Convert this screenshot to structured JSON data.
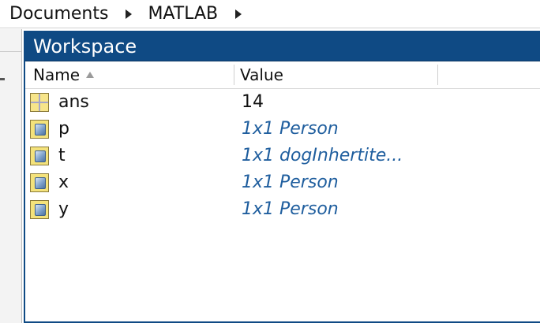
{
  "breadcrumb": {
    "items": [
      "Documents",
      "MATLAB"
    ]
  },
  "workspace": {
    "title": "Workspace",
    "columns": {
      "name": "Name",
      "value": "Value"
    },
    "variables": [
      {
        "name": "ans",
        "value": "14",
        "icon": "numeric-array-icon"
      },
      {
        "name": "p",
        "value": "1x1 Person",
        "icon": "object-icon"
      },
      {
        "name": "t",
        "value": "1x1 dogInhertite...",
        "icon": "object-icon"
      },
      {
        "name": "x",
        "value": "1x1 Person",
        "icon": "object-icon"
      },
      {
        "name": "y",
        "value": "1x1 Person",
        "icon": "object-icon"
      }
    ]
  },
  "colors": {
    "title_bar": "#0f4a84",
    "object_value_text": "#1f5e9e"
  }
}
